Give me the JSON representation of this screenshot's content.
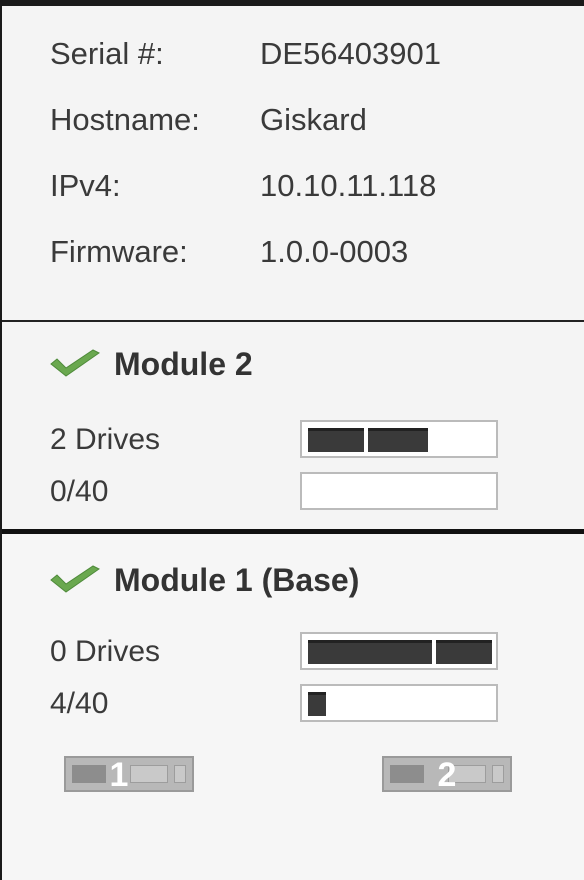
{
  "device": {
    "serial_label": "Serial #:",
    "serial_value": "DE56403901",
    "hostname_label": "Hostname:",
    "hostname_value": "Giskard",
    "ipv4_label": "IPv4:",
    "ipv4_value": "10.10.11.118",
    "firmware_label": "Firmware:",
    "firmware_value": "1.0.0-0003"
  },
  "modules": [
    {
      "title": "Module 2",
      "status_icon": "check-icon",
      "drives_text": "2 Drives",
      "capacity_text": "0/40",
      "drive_segments": 2,
      "usage_fraction": 0.0
    },
    {
      "title": "Module 1 (Base)",
      "status_icon": "check-icon",
      "drives_text": "0 Drives",
      "capacity_text": "4/40",
      "drive_segments": 2,
      "usage_fraction": 0.1,
      "slots": [
        {
          "label": "1"
        },
        {
          "label": "2"
        }
      ]
    }
  ],
  "colors": {
    "check_green": "#6aa84f",
    "bar_fill": "#3a3a3a",
    "panel_bg": "#f4f4f4"
  }
}
